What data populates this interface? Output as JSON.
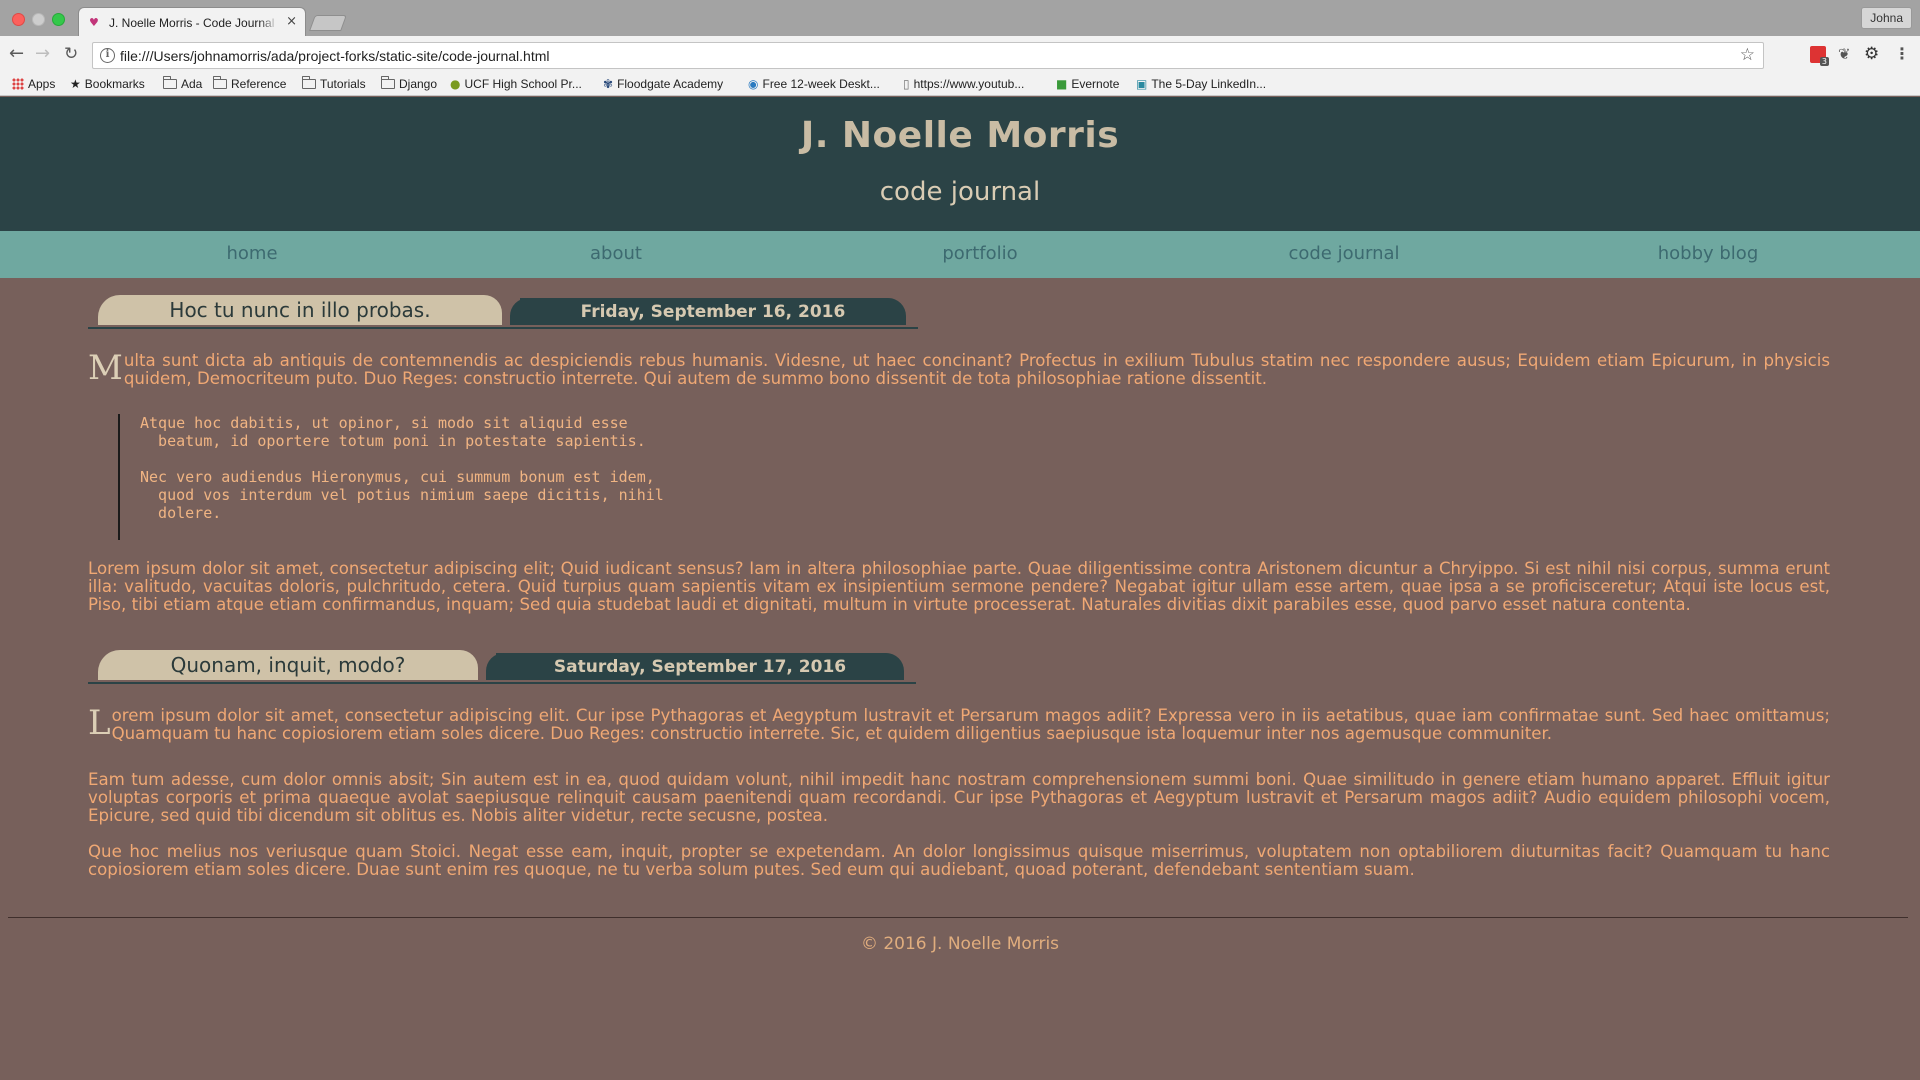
{
  "browser": {
    "tab_title": "J. Noelle Morris - Code Journal",
    "tab_close": "×",
    "profile": "Johna",
    "url": "file:///Users/johnamorris/ada/project-forks/static-site/code-journal.html",
    "ext_badge": "3",
    "bookmarks": [
      {
        "label": "Apps",
        "icon": "apps-grid-icon"
      },
      {
        "label": "Bookmarks",
        "icon": "star-icon"
      },
      {
        "label": "Ada",
        "icon": "folder-icon"
      },
      {
        "label": "Reference",
        "icon": "folder-icon"
      },
      {
        "label": "Tutorials",
        "icon": "folder-icon"
      },
      {
        "label": "Django",
        "icon": "folder-icon"
      },
      {
        "label": "UCF High School Pr...",
        "icon": "ucf-icon"
      },
      {
        "label": "Floodgate Academy",
        "icon": "floodgate-icon"
      },
      {
        "label": "Free 12-week Deskt...",
        "icon": "globe-icon"
      },
      {
        "label": "https://www.youtub...",
        "icon": "page-icon"
      },
      {
        "label": "Evernote",
        "icon": "evernote-icon"
      },
      {
        "label": "The 5-Day LinkedIn...",
        "icon": "linkedin-icon"
      }
    ]
  },
  "site": {
    "title": "J. Noelle Morris",
    "subtitle": "code journal",
    "nav": [
      "home",
      "about",
      "portfolio",
      "code journal",
      "hobby blog"
    ],
    "colors": {
      "header": "#2b4346",
      "nav": "#6fa8a0",
      "background": "#77605b",
      "text": "#f0a874"
    }
  },
  "posts": [
    {
      "title": "Hoc tu nunc in illo probas.",
      "date": "Friday, September 16, 2016",
      "intro_cap": "M",
      "intro": "ulta sunt dicta ab antiquis de contemnendis ac despiciendis rebus humanis. Videsne, ut haec concinant? Profectus in exilium Tubulus statim nec respondere ausus; Equidem etiam Epicurum, in physicis quidem, Democriteum puto. Duo Reges: constructio interrete. Qui autem de summo bono dissentit de tota philosophiae ratione dissentit.",
      "quote": "Atque hoc dabitis, ut opinor, si modo sit aliquid esse\n  beatum, id oportere totum poni in potestate sapientis.\n\nNec vero audiendus Hieronymus, cui summum bonum est idem,\n  quod vos interdum vel potius nimium saepe dicitis, nihil\n  dolere.",
      "para2": "Lorem ipsum dolor sit amet, consectetur adipiscing elit; Quid iudicant sensus? Iam in altera philosophiae parte. Quae diligentissime contra Aristonem dicuntur a Chryippo. Si est nihil nisi corpus, summa erunt illa: valitudo, vacuitas doloris, pulchritudo, cetera. Quid turpius quam sapientis vitam ex insipientium sermone pendere? Negabat igitur ullam esse artem, quae ipsa a se proficisceretur; Atqui iste locus est, Piso, tibi etiam atque etiam confirmandus, inquam; Sed quia studebat laudi et dignitati, multum in virtute processerat. Naturales divitias dixit parabiles esse, quod parvo esset natura contenta."
    },
    {
      "title": "Quonam, inquit, modo?",
      "date": "Saturday, September 17, 2016",
      "intro_cap": "L",
      "intro": "orem ipsum dolor sit amet, consectetur adipiscing elit. Cur ipse Pythagoras et Aegyptum lustravit et Persarum magos adiit? Expressa vero in iis aetatibus, quae iam confirmatae sunt. Sed haec omittamus; Quamquam tu hanc copiosiorem etiam soles dicere. Duo Reges: constructio interrete. Sic, et quidem diligentius saepiusque ista loquemur inter nos agemusque communiter.",
      "para2": "Eam tum adesse, cum dolor omnis absit; Sin autem est in ea, quod quidam volunt, nihil impedit hanc nostram comprehensionem summi boni. Quae similitudo in genere etiam humano apparet. Effluit igitur voluptas corporis et prima quaeque avolat saepiusque relinquit causam paenitendi quam recordandi. Cur ipse Pythagoras et Aegyptum lustravit et Persarum magos adiit? Audio equidem philosophi vocem, Epicure, sed quid tibi dicendum sit oblitus es. Nobis aliter videtur, recte secusne, postea.",
      "para3": "Que hoc melius nos veriusque quam Stoici. Negat esse eam, inquit, propter se expetendam. An dolor longissimus quisque miserrimus, voluptatem non optabiliorem diuturnitas facit? Quamquam tu hanc copiosiorem etiam soles dicere. Duae sunt enim res quoque, ne tu verba solum putes. Sed eum qui audiebant, quoad poterant, defendebant sententiam suam."
    }
  ],
  "footer": "© 2016 J. Noelle Morris"
}
